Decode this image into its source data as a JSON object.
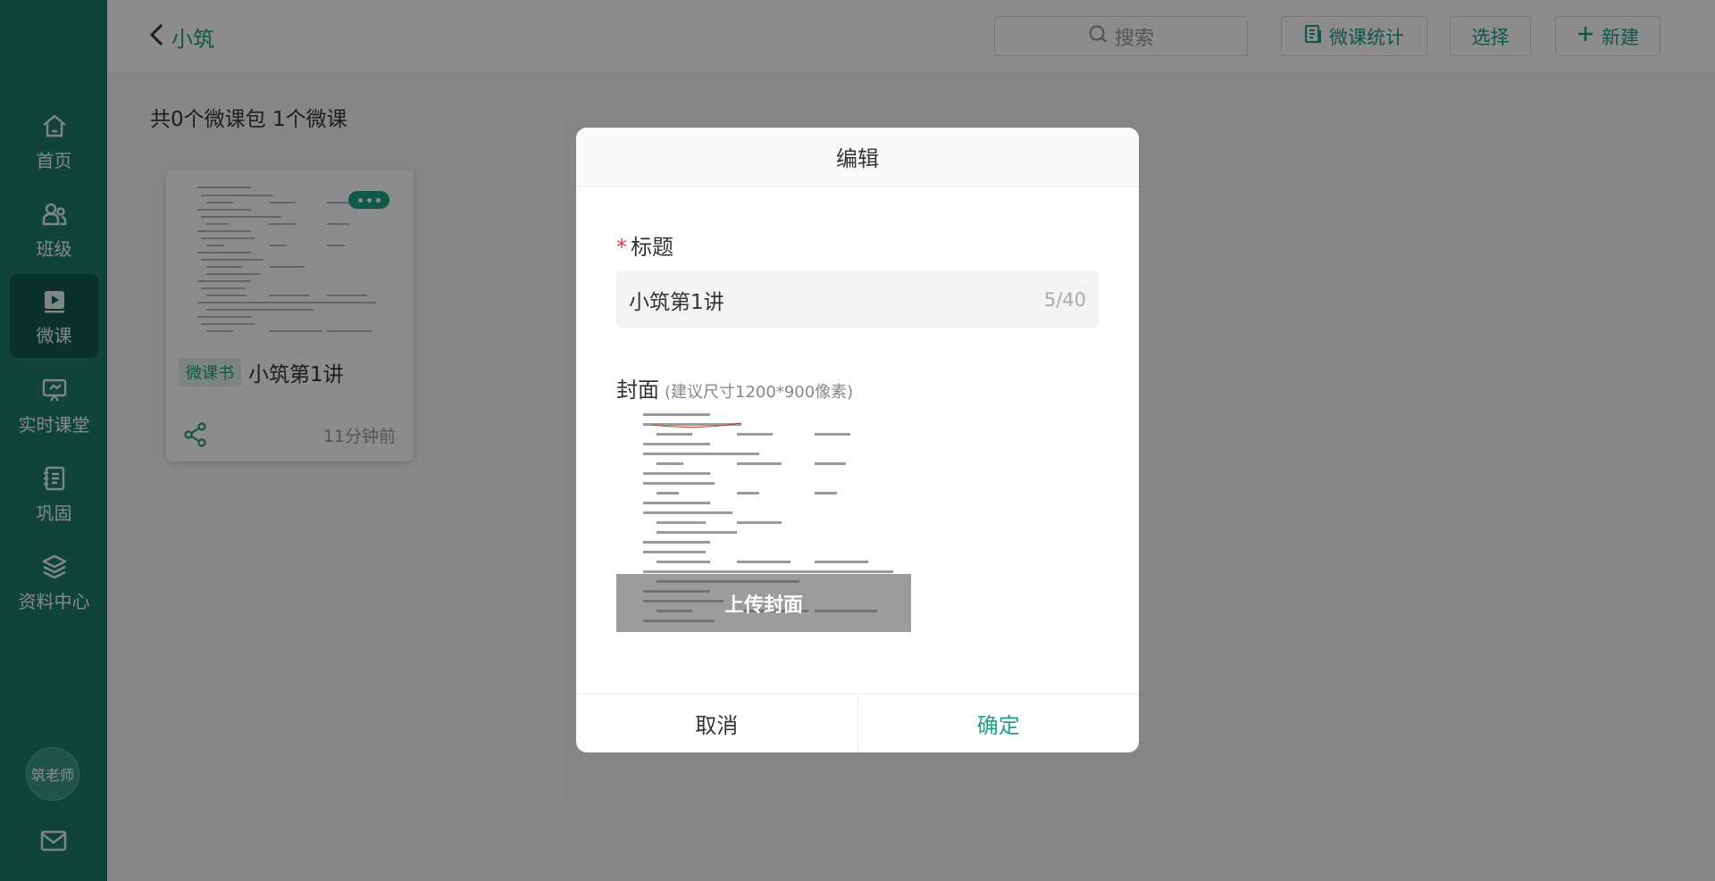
{
  "sidebar": {
    "items": [
      {
        "label": "首页",
        "icon": "home-icon"
      },
      {
        "label": "班级",
        "icon": "users-icon"
      },
      {
        "label": "微课",
        "icon": "video-icon"
      },
      {
        "label": "实时课堂",
        "icon": "presentation-icon"
      },
      {
        "label": "巩固",
        "icon": "notebook-icon"
      },
      {
        "label": "资料中心",
        "icon": "layers-icon"
      }
    ],
    "avatar_text": "筑老师",
    "mail_icon": "mail-icon"
  },
  "header": {
    "back_label": "小筑",
    "search_placeholder": "搜索",
    "stats_button": "微课统计",
    "select_button": "选择",
    "new_button": "新建"
  },
  "main": {
    "summary": "共0个微课包  1个微课",
    "card": {
      "tag": "微课书",
      "title": "小筑第1讲",
      "time": "11分钟前"
    }
  },
  "modal": {
    "title": "编辑",
    "title_field_label": "标题",
    "title_value": "小筑第1讲",
    "title_counter": "5/40",
    "cover_label": "封面",
    "cover_hint": "(建议尺寸1200*900像素)",
    "cover_upload": "上传封面",
    "cancel": "取消",
    "confirm": "确定"
  },
  "colors": {
    "sidebar_bg": "#1f7d68",
    "accent": "#1fa283",
    "required": "#e23c3c"
  }
}
